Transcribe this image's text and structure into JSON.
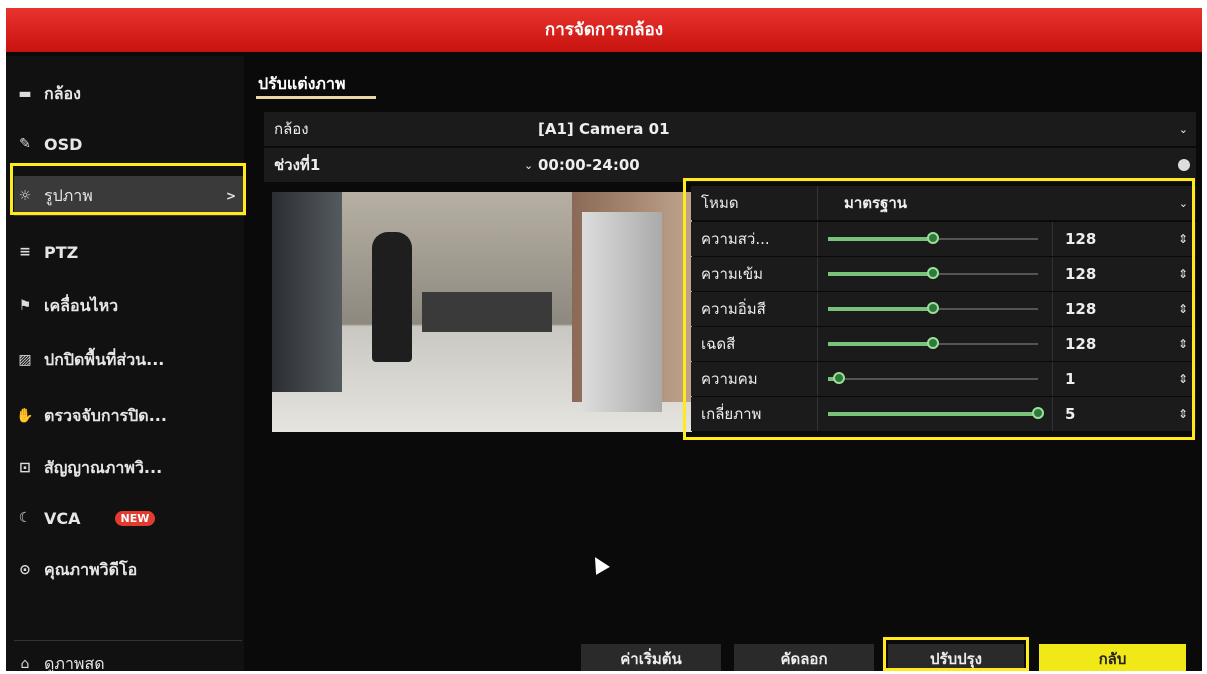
{
  "title": "การจัดการกล้อง",
  "sidebar": {
    "items": [
      {
        "label": "กล้อง",
        "icon": "camera-icon"
      },
      {
        "label": "OSD",
        "icon": "osd-icon"
      },
      {
        "label": "รูปภาพ",
        "icon": "image-icon"
      },
      {
        "label": "PTZ",
        "icon": "ptz-icon"
      },
      {
        "label": "เคลื่อนไหว",
        "icon": "motion-icon"
      },
      {
        "label": "ปกปิดพื้นที่ส่วน...",
        "icon": "privacy-mask-icon"
      },
      {
        "label": "ตรวจจับการปิด...",
        "icon": "tamper-icon"
      },
      {
        "label": "สัญญาณภาพวิ...",
        "icon": "video-loss-icon"
      },
      {
        "label": "VCA",
        "icon": "vca-icon",
        "badge": "NEW"
      },
      {
        "label": "คุณภาพวิดีโอ",
        "icon": "video-quality-icon"
      }
    ],
    "live_view": "ดูภาพสด",
    "active_chevron": ">"
  },
  "tab": "ปรับแต่งภาพ",
  "camera_row": {
    "label": "กล้อง",
    "value": "[A1] Camera 01"
  },
  "period_row": {
    "label": "ช่วงที่1",
    "value": "00:00-24:00"
  },
  "params": {
    "mode": {
      "label": "โหมด",
      "value": "มาตรฐาน"
    },
    "sliders": [
      {
        "label": "ความสว่...",
        "value": "128",
        "level": 0.5
      },
      {
        "label": "ความเข้ม",
        "value": "128",
        "level": 0.5
      },
      {
        "label": "ความอิ่มสี",
        "value": "128",
        "level": 0.5
      },
      {
        "label": "เฉดสี",
        "value": "128",
        "level": 0.5
      },
      {
        "label": "ความคม",
        "value": "1",
        "level": 0.05
      },
      {
        "label": "เกลี่ยภาพ",
        "value": "5",
        "level": 1.0
      }
    ]
  },
  "buttons": {
    "default": "ค่าเริ่มต้น",
    "copy": "คัดลอก",
    "apply": "ปรับปรุง",
    "back": "กลับ"
  },
  "colors": {
    "title_red": "#d8201a",
    "highlight_yellow": "#ffeb1a",
    "slider_green": "#7ac17a"
  }
}
